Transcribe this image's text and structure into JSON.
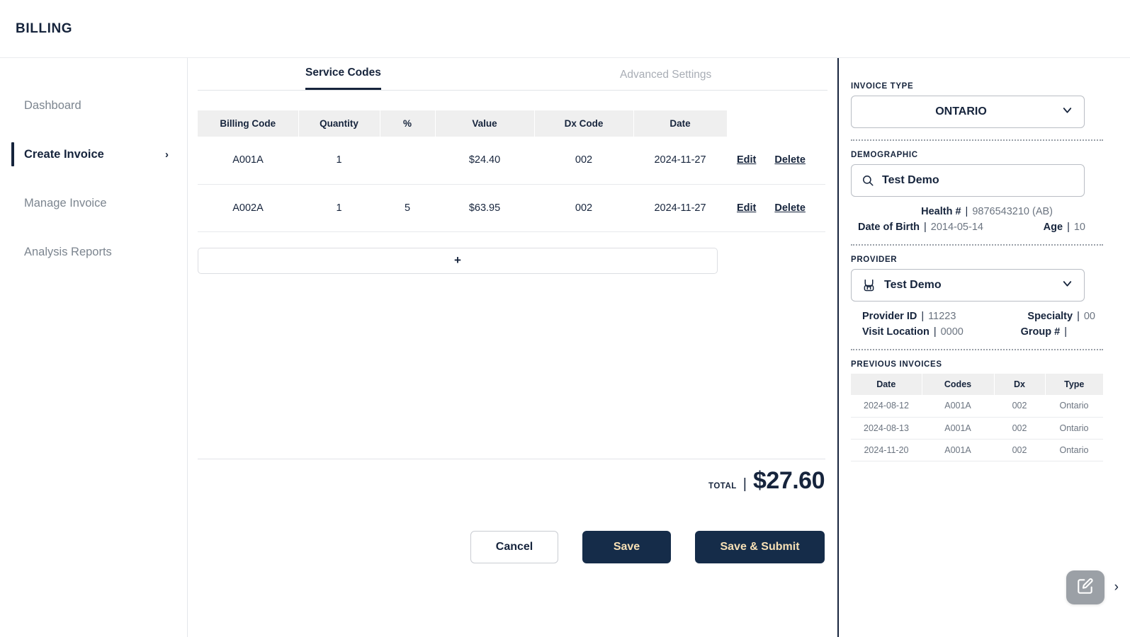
{
  "header": {
    "brand": "BILLING"
  },
  "sidebar": {
    "items": [
      {
        "label": "Dashboard",
        "active": false,
        "chevron": ""
      },
      {
        "label": "Create Invoice",
        "active": true,
        "chevron": "›"
      },
      {
        "label": "Manage Invoice",
        "active": false,
        "chevron": ""
      },
      {
        "label": "Analysis Reports",
        "active": false,
        "chevron": ""
      }
    ]
  },
  "main": {
    "tabs": [
      {
        "label": "Service Codes",
        "active": true
      },
      {
        "label": "Advanced Settings",
        "active": false
      }
    ],
    "service_table": {
      "columns": [
        "Billing Code",
        "Quantity",
        "%",
        "Value",
        "Dx Code",
        "Date"
      ],
      "rows": [
        {
          "billing_code": "A001A",
          "quantity": "1",
          "percent": "",
          "value": "$24.40",
          "dx_code": "002",
          "date": "2024-11-27",
          "edit": "Edit",
          "delete": "Delete"
        },
        {
          "billing_code": "A002A",
          "quantity": "1",
          "percent": "5",
          "value": "$63.95",
          "dx_code": "002",
          "date": "2024-11-27",
          "edit": "Edit",
          "delete": "Delete"
        }
      ]
    },
    "add_row_label": "+",
    "total": {
      "label": "TOTAL",
      "separator": "|",
      "value": "$27.60"
    },
    "buttons": {
      "cancel": "Cancel",
      "save": "Save",
      "save_submit": "Save & Submit"
    }
  },
  "right_panel": {
    "invoice_type": {
      "label": "INVOICE TYPE",
      "value": "ONTARIO"
    },
    "demographic": {
      "label": "DEMOGRAPHIC",
      "value": "Test Demo",
      "health_key": "Health #",
      "health_value": "9876543210 (AB)",
      "dob_key": "Date of Birth",
      "dob_value": "2014-05-14",
      "age_key": "Age",
      "age_value": "10"
    },
    "provider": {
      "label": "PROVIDER",
      "value": "Test Demo",
      "provider_id_key": "Provider ID",
      "provider_id_value": "11223",
      "specialty_key": "Specialty",
      "specialty_value": "00",
      "visit_location_key": "Visit Location",
      "visit_location_value": "0000",
      "group_key": "Group #",
      "group_value": ""
    },
    "previous_invoices": {
      "label": "PREVIOUS INVOICES",
      "columns": [
        "Date",
        "Codes",
        "Dx",
        "Type"
      ],
      "rows": [
        {
          "date": "2024-08-12",
          "codes": "A001A",
          "dx": "002",
          "type": "Ontario"
        },
        {
          "date": "2024-08-13",
          "codes": "A001A",
          "dx": "002",
          "type": "Ontario"
        },
        {
          "date": "2024-11-20",
          "codes": "A001A",
          "dx": "002",
          "type": "Ontario"
        }
      ]
    }
  },
  "fab": {
    "chevron": "›"
  },
  "colors": {
    "navy": "#16243c",
    "button_navy": "#152c49",
    "button_text_cream": "#f7e0b5",
    "muted": "#7c858f",
    "table_header_bg": "#efefef",
    "fab_gray": "#9ba0a6"
  }
}
